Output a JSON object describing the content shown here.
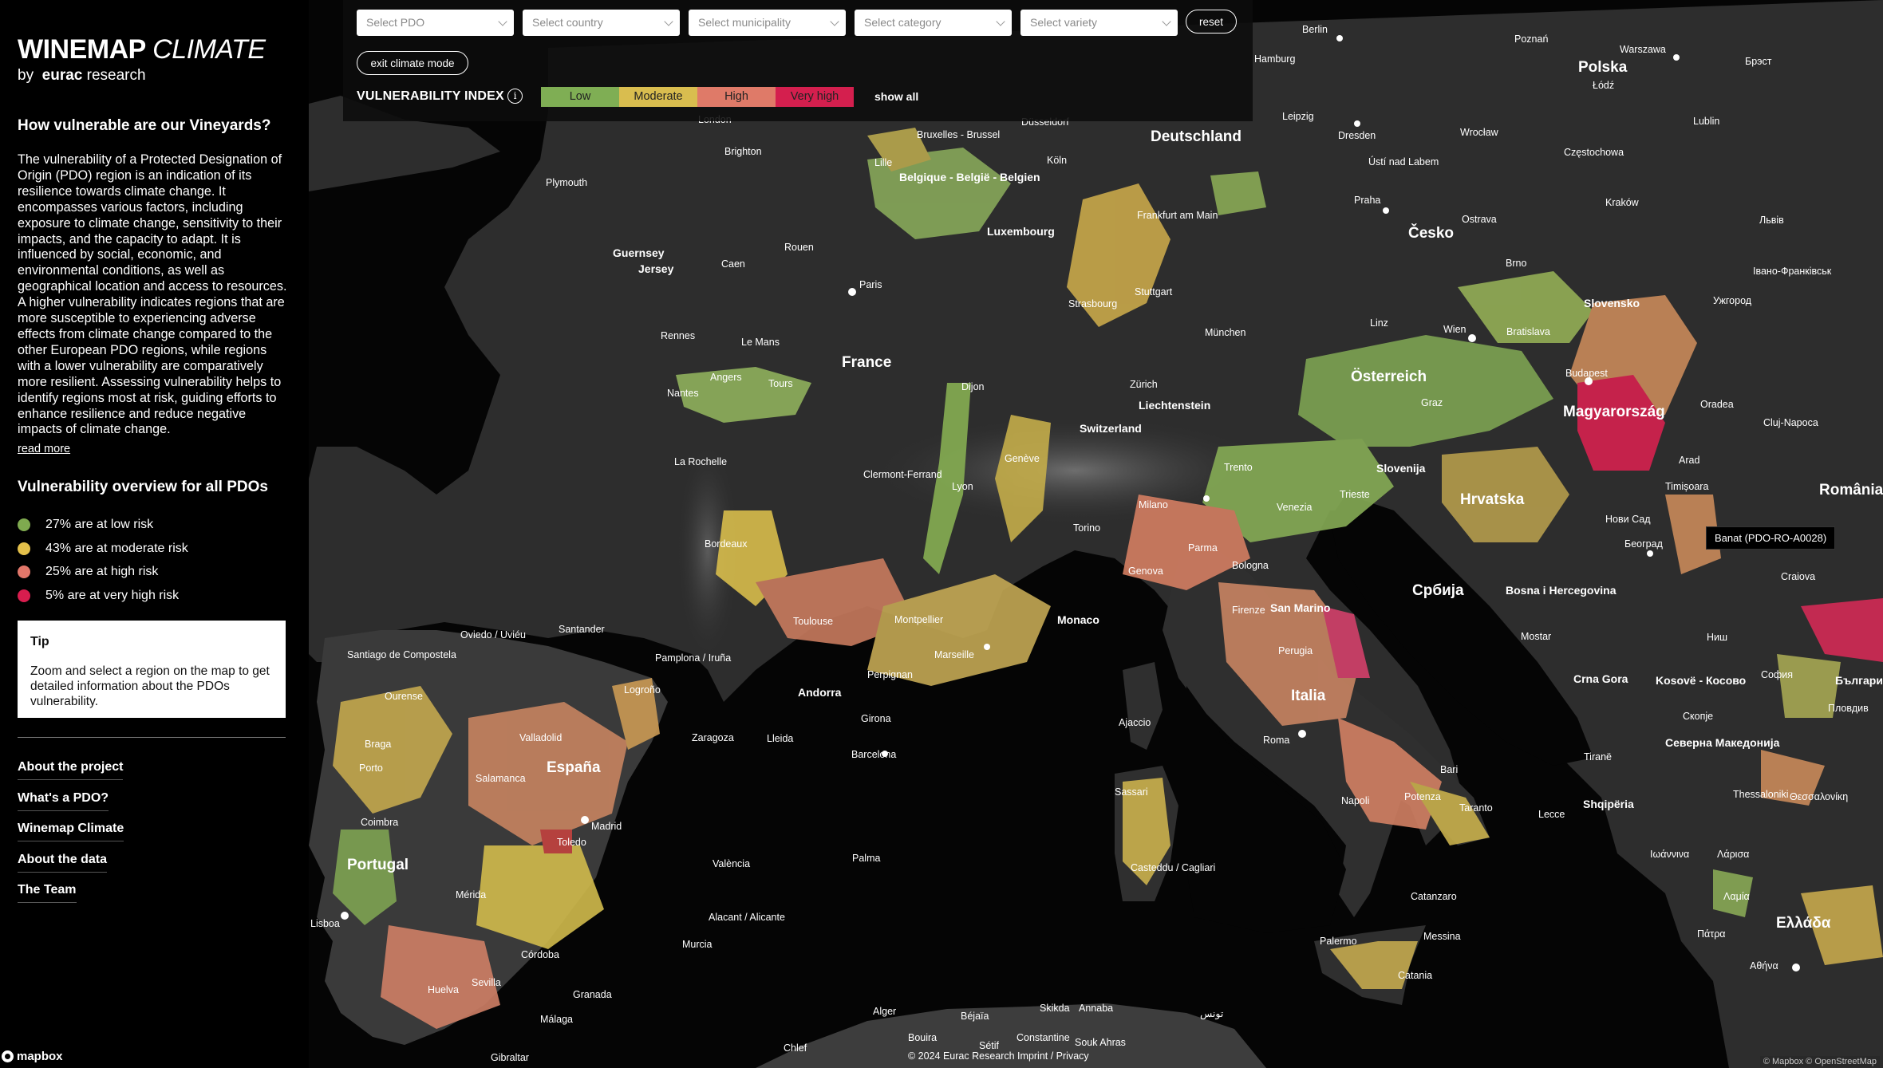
{
  "brand": {
    "title_bold": "WINEMAP",
    "title_light": "CLIMATE",
    "by": "by",
    "org_bold": "eurac",
    "org_light": "research"
  },
  "sidebar": {
    "heading": "How vulnerable are our Vineyards?",
    "intro": "The vulnerability of a Protected Designation of Origin (PDO) region is an indication of its resilience towards climate change. It encompasses various factors, including exposure to climate change, sensitivity to their impacts, and the capacity to adapt. It is influenced by social, economic, and environmental conditions, as well as geographical location and access to resources. A higher vulnerability indicates regions that are more susceptible to experiencing adverse effects from climate change compared to the other European PDO regions, while regions with a lower vulnerability are comparatively more resilient. Assessing vulnerability helps to identify regions most at risk, guiding efforts to enhance resilience and reduce negative impacts of climate change.",
    "read_more": "read more",
    "overview_heading": "Vulnerability overview for all PDOs",
    "risks": [
      {
        "label": "27% are at low risk",
        "color": "#7faa4f"
      },
      {
        "label": "43% are at moderate risk",
        "color": "#e3c04a"
      },
      {
        "label": "25% are at high risk",
        "color": "#e2776a"
      },
      {
        "label": "5% are at very high risk",
        "color": "#d81d4e"
      }
    ],
    "tip": {
      "title": "Tip",
      "text": "Zoom and select a region on the map to get detailed information about the PDOs vulnerability."
    },
    "links": [
      "About the project",
      "What's a PDO?",
      "Winemap Climate",
      "About the data",
      "The Team"
    ]
  },
  "controls": {
    "selects": [
      "Select PDO",
      "Select country",
      "Select municipality",
      "Select category",
      "Select variety"
    ],
    "reset": "reset",
    "exit_climate": "exit climate mode",
    "vulnerability_title": "VULNERABILITY INDEX",
    "info_glyph": "i",
    "legend": [
      {
        "label": "Low",
        "color": "#7fae54"
      },
      {
        "label": "Moderate",
        "color": "#d9bd4f"
      },
      {
        "label": "High",
        "color": "#df7a68"
      },
      {
        "label": "Very high",
        "color": "#d41f4e"
      }
    ],
    "show_all": "show all"
  },
  "map": {
    "countries": [
      "Deutschland",
      "Polska",
      "Belgique - België - Belgien",
      "Luxembourg",
      "Česko",
      "France",
      "Österreich",
      "Slovensko",
      "Magyarország",
      "Switzerland",
      "Liechtenstein",
      "Slovenija",
      "Hrvatska",
      "România",
      "Bosna i Hercegovina",
      "Србија",
      "Monaco",
      "San Marino",
      "Italia",
      "Andorra",
      "España",
      "Portugal",
      "Crna Gora",
      "Kosovë - Косово",
      "Северна Македонија",
      "Shqipëria",
      "България",
      "Ελλάδα",
      "Guernsey",
      "Jersey"
    ],
    "cities": [
      "Berlin",
      "Poznań",
      "Warszawa",
      "Брэст",
      "Hamburg",
      "Leipzig",
      "Dresden",
      "Wrocław",
      "Łódź",
      "Lublin",
      "Częstochowa",
      "Kraków",
      "Ostrava",
      "Львів",
      "Brno",
      "Praha",
      "Ústí nad Labem",
      "London",
      "Brighton",
      "Plymouth",
      "Bruxelles - Brussel",
      "Lille",
      "Köln",
      "Düsseldorf",
      "Frankfurt am Main",
      "Stuttgart",
      "Strasbourg",
      "München",
      "Linz",
      "Wien",
      "Bratislava",
      "Budapest",
      "Ужгород",
      "Івано-Франківськ",
      "Paris",
      "Caen",
      "Rouen",
      "Rennes",
      "Le Mans",
      "Angers",
      "Tours",
      "Nantes",
      "Dijon",
      "Zürich",
      "Graz",
      "Oradea",
      "Cluj-Napoca",
      "Arad",
      "Timișoara",
      "La Rochelle",
      "Clermont-Ferrand",
      "Lyon",
      "Genève",
      "Milano",
      "Torino",
      "Trento",
      "Venezia",
      "Trieste",
      "Нови Сад",
      "Београд",
      "Craiova",
      "Bordeaux",
      "Toulouse",
      "Montpellier",
      "Marseille",
      "Genova",
      "Parma",
      "Bologna",
      "Firenze",
      "Perugia",
      "Roma",
      "Napoli",
      "Bari",
      "Potenza",
      "Taranto",
      "Lecce",
      "Catanzaro",
      "Messina",
      "Palermo",
      "Catania",
      "Mostar",
      "Ниш",
      "София",
      "Пловдив",
      "Скопје",
      "Tiranë",
      "Thessaloniki",
      "Θεσσαλονίκη",
      "Ιωάννινα",
      "Λάρισα",
      "Λαμία",
      "Πάτρα",
      "Αθήνα",
      "Oviedo / Uviéu",
      "Santander",
      "Santiago de Compostela",
      "Ourense",
      "Braga",
      "Porto",
      "Coimbra",
      "Lisboa",
      "Pamplona / Iruña",
      "Logroño",
      "Valladolid",
      "Zaragoza",
      "Lleida",
      "Girona",
      "Barcelona",
      "Perpignan",
      "Salamanca",
      "Madrid",
      "Toledo",
      "València",
      "Palma",
      "Mérida",
      "Alacant / Alicante",
      "Murcia",
      "Córdoba",
      "Sevilla",
      "Huelva",
      "Granada",
      "Málaga",
      "Gibraltar",
      "Ajaccio",
      "Sassari",
      "Casteddu / Cagliari",
      "Alger",
      "Béjaïa",
      "Skikda",
      "Annaba",
      "Constantine",
      "Souk Ahras",
      "Bouira",
      "Sétif",
      "Chlef",
      "تونس"
    ],
    "tooltip": "Banat (PDO-RO-A0028)"
  },
  "footer": {
    "mapbox": "mapbox",
    "attribution": "© 2024 Eurac Research   Imprint / Privacy",
    "attribution_right": "© Mapbox © OpenStreetMap"
  }
}
